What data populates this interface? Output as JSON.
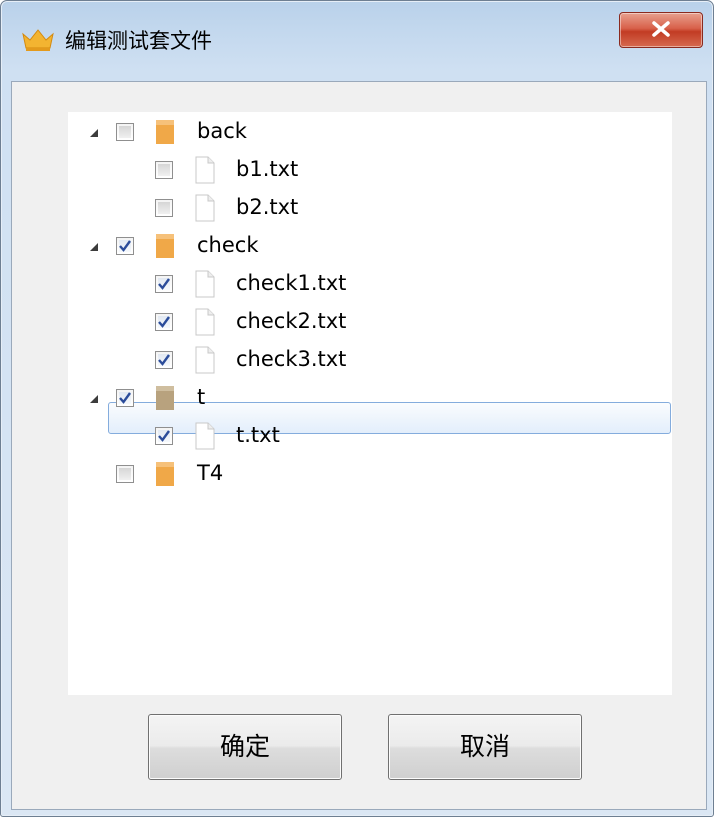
{
  "window": {
    "title": "编辑测试套文件"
  },
  "tree": {
    "items": [
      {
        "label": "back",
        "type": "folder",
        "checked": false,
        "expanded": true
      },
      {
        "label": "b1.txt",
        "type": "file",
        "checked": false
      },
      {
        "label": "b2.txt",
        "type": "file",
        "checked": false
      },
      {
        "label": "check",
        "type": "folder",
        "checked": true,
        "expanded": true
      },
      {
        "label": "check1.txt",
        "type": "file",
        "checked": true
      },
      {
        "label": "check2.txt",
        "type": "file",
        "checked": true
      },
      {
        "label": "check3.txt",
        "type": "file",
        "checked": true
      },
      {
        "label": "t",
        "type": "folder",
        "checked": true,
        "expanded": true,
        "selected": true
      },
      {
        "label": "t.txt",
        "type": "file",
        "checked": true
      },
      {
        "label": "T4",
        "type": "folder",
        "checked": false,
        "expanded": false
      }
    ]
  },
  "buttons": {
    "ok_label": "确定",
    "cancel_label": "取消"
  },
  "colors": {
    "folder_orange": "#f0a848",
    "folder_selected": "#b8a27e",
    "selection_border": "#84acdd",
    "check_blue": "#2b4c9a",
    "close_red": "#c9432b"
  },
  "icons": {
    "app": "crown-icon",
    "close": "close-icon",
    "folder": "folder-icon",
    "file": "file-icon",
    "expander": "expand-triangle-icon",
    "check": "checkmark-icon"
  }
}
